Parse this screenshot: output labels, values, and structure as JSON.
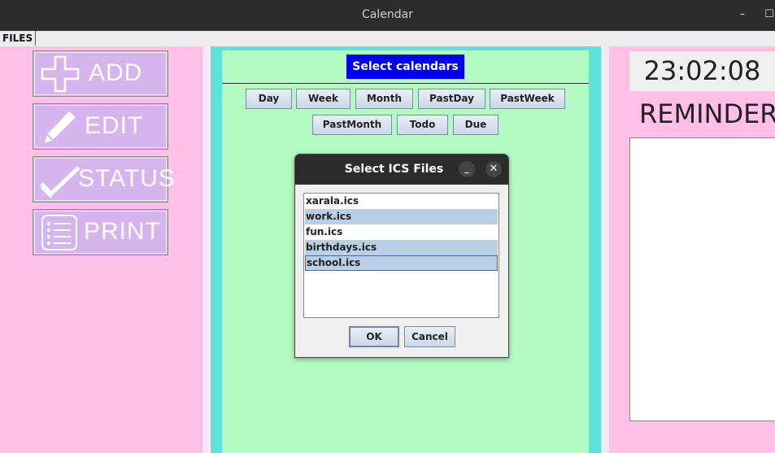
{
  "window": {
    "title": "Calendar"
  },
  "menubar": {
    "files": "FILES"
  },
  "sidebar": {
    "buttons": [
      {
        "label": "ADD",
        "icon": "plus-icon"
      },
      {
        "label": "EDIT",
        "icon": "pencil-icon"
      },
      {
        "label": "STATUS",
        "icon": "checkmark-icon"
      },
      {
        "label": "PRINT",
        "icon": "list-icon"
      }
    ]
  },
  "main": {
    "select_calendars": "Select calendars",
    "views_row1": [
      "Day",
      "Week",
      "Month",
      "PastDay",
      "PastWeek"
    ],
    "views_row2": [
      "PastMonth",
      "Todo",
      "Due"
    ]
  },
  "right": {
    "clock": "23:02:08",
    "reminders_title": "REMINDERS"
  },
  "dialog": {
    "title": "Select ICS Files",
    "files": [
      {
        "name": "xarala.ics",
        "selected": false
      },
      {
        "name": "work.ics",
        "selected": true
      },
      {
        "name": "fun.ics",
        "selected": false
      },
      {
        "name": "birthdays.ics",
        "selected": true
      },
      {
        "name": "school.ics",
        "selected": true
      }
    ],
    "ok": "OK",
    "cancel": "Cancel"
  },
  "colors": {
    "pink_bg": "#ffbfe9",
    "sidebar_button": "#d6b5ef",
    "cyan_frame": "#5fe3d9",
    "green_panel": "#b3f9c2",
    "select_button": "#0000f0",
    "list_selection": "#b8cfe5"
  }
}
